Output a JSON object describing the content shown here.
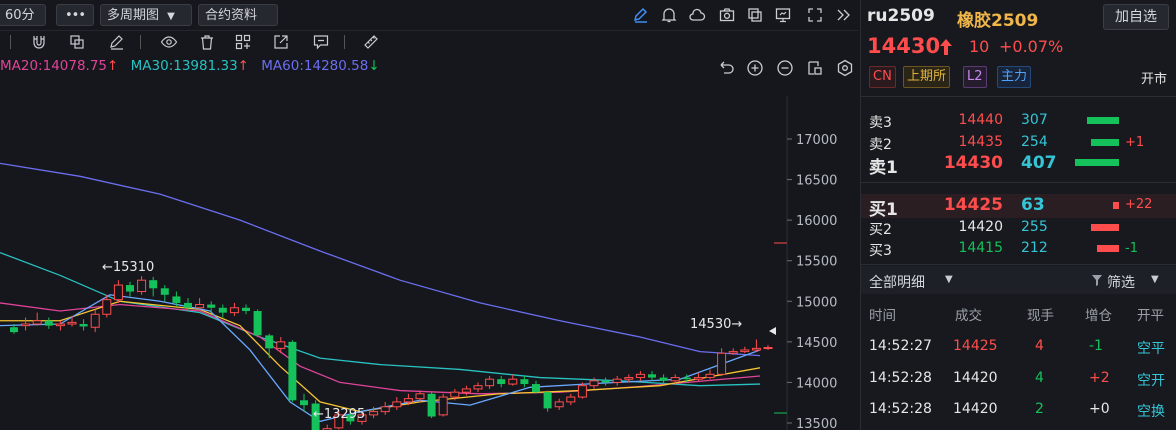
{
  "topbar": {
    "period": "60分",
    "more": "•••",
    "multi_period": "多周期图",
    "contract_info": "合约资料"
  },
  "ma": {
    "ma20": "MA20:14078.75",
    "ma30": "MA30:13981.33",
    "ma60": "MA60:14280.58",
    "colors": {
      "ma20": "#e0449a",
      "ma30": "#29c1c1",
      "ma60": "#6b6ef0"
    }
  },
  "chart": {
    "y_ticks": [
      "17000",
      "16500",
      "16000",
      "15500",
      "15000",
      "14500",
      "14000",
      "13500"
    ],
    "high_label": "←15310",
    "low_label": "←13295",
    "last_label": "14530→",
    "colors": {
      "up": "#ff4d4d",
      "down": "#15c15a",
      "ma5": "#d9d9d9",
      "ma10": "#f5c431"
    }
  },
  "quote": {
    "code": "ru2509",
    "name": "橡胶2509",
    "add_watch": "加自选",
    "price": "14430",
    "change": "10",
    "change_pct": "+0.07%",
    "tags": {
      "cn": "CN",
      "exchange": "上期所",
      "level": "L2",
      "main": "主力"
    },
    "market_status": "开市"
  },
  "orderbook": {
    "asks": [
      {
        "label": "卖3",
        "price": "14440",
        "vol": "307",
        "chg": ""
      },
      {
        "label": "卖2",
        "price": "14435",
        "vol": "254",
        "chg": "+1"
      },
      {
        "label": "卖1",
        "price": "14430",
        "vol": "407",
        "chg": ""
      }
    ],
    "bids": [
      {
        "label": "买1",
        "price": "14425",
        "vol": "63",
        "chg": "+22"
      },
      {
        "label": "买2",
        "price": "14420",
        "vol": "255",
        "chg": ""
      },
      {
        "label": "买3",
        "price": "14415",
        "vol": "212",
        "chg": "-1"
      }
    ]
  },
  "ticks": {
    "title": "全部明细",
    "filter": "筛选",
    "headers": [
      "时间",
      "成交",
      "现手",
      "增仓",
      "开平"
    ],
    "rows": [
      {
        "time": "14:52:27",
        "price": "14425",
        "qty": "4",
        "oi": "-1",
        "type": "空平"
      },
      {
        "time": "14:52:28",
        "price": "14420",
        "qty": "4",
        "oi": "+2",
        "type": "空开"
      },
      {
        "time": "14:52:28",
        "price": "14420",
        "qty": "2",
        "oi": "+0",
        "type": "空换"
      }
    ]
  }
}
